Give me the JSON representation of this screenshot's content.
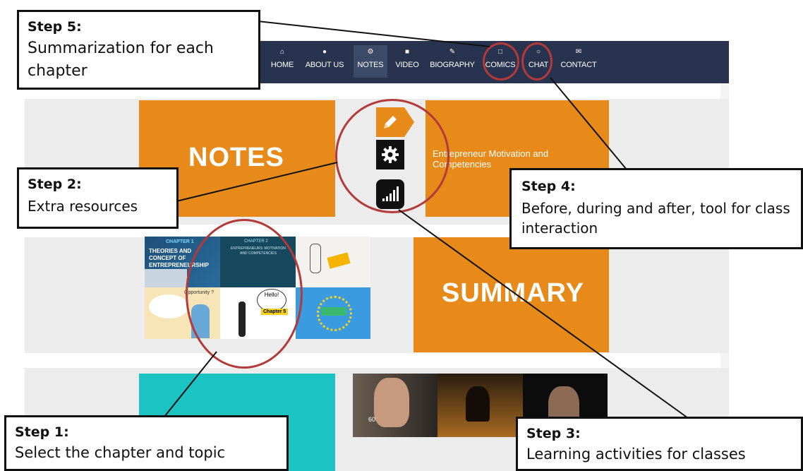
{
  "nav": {
    "items": [
      {
        "icon": "home-icon",
        "glyph": "⌂",
        "label": "HOME"
      },
      {
        "icon": "user-icon",
        "glyph": "●",
        "label": "ABOUT US"
      },
      {
        "icon": "cogs-icon",
        "glyph": "⚙",
        "label": "NOTES"
      },
      {
        "icon": "briefcase-icon",
        "glyph": "■",
        "label": "VIDEO"
      },
      {
        "icon": "pencil-icon",
        "glyph": "✎",
        "label": "BIOGRAPHY"
      },
      {
        "icon": "file-icon",
        "glyph": "□",
        "label": "COMICS"
      },
      {
        "icon": "chat-icon",
        "glyph": "○",
        "label": "CHAT"
      },
      {
        "icon": "envelope-icon",
        "glyph": "✉",
        "label": "CONTACT"
      }
    ],
    "active": "NOTES"
  },
  "content": {
    "notes_title": "NOTES",
    "topic_title": "Entrepreneur Motivation and Competencies",
    "summary_title": "SUMMARY",
    "tools": [
      "pencil-icon",
      "gear-icon",
      "signal-bars-icon"
    ],
    "thumbnails": {
      "chapter1_label": "CHAPTER 1",
      "chapter1_title": "THEORIES AND CONCEPT OF ENTREPRENEURSHIP",
      "chapter2_label": "CHAPTER 2",
      "chapter2_title": "ENTREPRENEURS: MOTIVATION AND COMPETENCIES",
      "opportunity_text": "Opportunity ?",
      "hello_text": "Hello!",
      "chapter_badge": "Chapter 5",
      "video_caption": "60"
    }
  },
  "callouts": {
    "step5": {
      "title": "Step 5:",
      "body": "Summarization for each chapter"
    },
    "step2": {
      "title": "Step 2:",
      "body": "Extra resources"
    },
    "step4": {
      "title": "Step 4:",
      "body": "Before, during and after, tool for class interaction"
    },
    "step1": {
      "title": "Step 1:",
      "body": "Select the chapter and topic"
    },
    "step3": {
      "title": "Step 3:",
      "body": "Learning activities for classes"
    }
  },
  "colors": {
    "navbar": "#27334f",
    "accent_orange": "#e88a1a",
    "teal": "#1cc3c3",
    "highlight_ring": "#b33a3a"
  }
}
